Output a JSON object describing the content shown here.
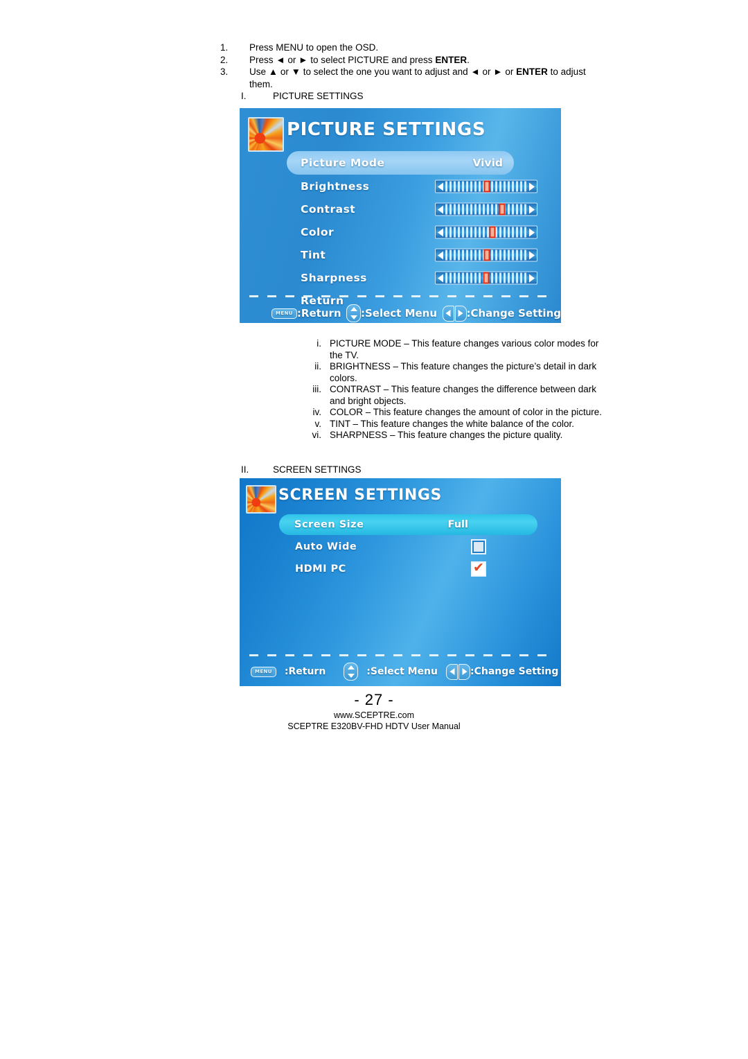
{
  "steps": [
    {
      "num": "1.",
      "text": "Press MENU to open the OSD."
    },
    {
      "num": "2.",
      "text": "Press ◄ or ► to select PICTURE and press ",
      "bold": "ENTER",
      "tail": "."
    },
    {
      "num": "3.",
      "text": "Use ▲ or ▼ to select the one you want to adjust and ◄ or ► or ",
      "bold": "ENTER",
      "tail": " to adjust them."
    }
  ],
  "sections": {
    "one": {
      "num": "I.",
      "label": "PICTURE SETTINGS"
    },
    "two": {
      "num": "II.",
      "label": "SCREEN SETTINGS"
    }
  },
  "picture_osd": {
    "title": "PICTURE SETTINGS",
    "thumbnail_icon": "flower-photo-icon",
    "rows": [
      {
        "label": "Picture Mode",
        "value": "Vivid",
        "type": "value",
        "selected": true
      },
      {
        "label": "Brightness",
        "type": "slider",
        "percent": 50,
        "selected": false
      },
      {
        "label": "Contrast",
        "type": "slider",
        "percent": 68,
        "selected": false
      },
      {
        "label": "Color",
        "type": "slider",
        "percent": 57,
        "selected": false
      },
      {
        "label": "Tint",
        "type": "slider",
        "percent": 50,
        "selected": false
      },
      {
        "label": "Sharpness",
        "type": "slider",
        "percent": 49,
        "selected": false
      },
      {
        "label": "Return",
        "type": "plain",
        "selected": false
      }
    ],
    "footer": {
      "menu_key": "MENU",
      "return_label": ":Return",
      "select_label": ":Select Menu",
      "change_label": ":Change Setting"
    }
  },
  "screen_osd": {
    "title": "SCREEN SETTINGS",
    "thumbnail_icon": "flower-photo-icon",
    "rows": [
      {
        "label": "Screen Size",
        "value": "Full",
        "type": "value",
        "selected": true
      },
      {
        "label": "Auto Wide",
        "type": "checkbox",
        "checked": false,
        "selected": false
      },
      {
        "label": "HDMI PC",
        "type": "checkbox",
        "checked": true,
        "selected": false
      }
    ],
    "footer": {
      "menu_key": "MENU",
      "return_label": ":Return",
      "select_label": ":Select Menu",
      "change_label": ":Change Setting"
    }
  },
  "descriptions": [
    {
      "num": "i.",
      "text": "PICTURE MODE – This feature changes various color modes for the TV."
    },
    {
      "num": "ii.",
      "text": "BRIGHTNESS – This feature changes the picture’s detail in dark colors."
    },
    {
      "num": "iii.",
      "text": "CONTRAST – This feature changes the difference between dark and bright objects."
    },
    {
      "num": "iv.",
      "text": "COLOR – This feature changes the amount of color in the picture."
    },
    {
      "num": "v.",
      "text": "TINT – This feature changes the white balance of the color."
    },
    {
      "num": "vi.",
      "text": "SHARPNESS – This feature changes the picture quality."
    }
  ],
  "page_footer": {
    "page_number": "- 27 -",
    "website": "www.SCEPTRE.com",
    "manual_line": "SCEPTRE E320BV-FHD HDTV User Manual"
  },
  "colors": {
    "osd_blue": "#2f8fd4",
    "highlight_picture": "#a6d6f7",
    "highlight_screen": "#49d2f0",
    "slider_thumb_border": "#e02b10",
    "check_color": "#e04a20"
  }
}
